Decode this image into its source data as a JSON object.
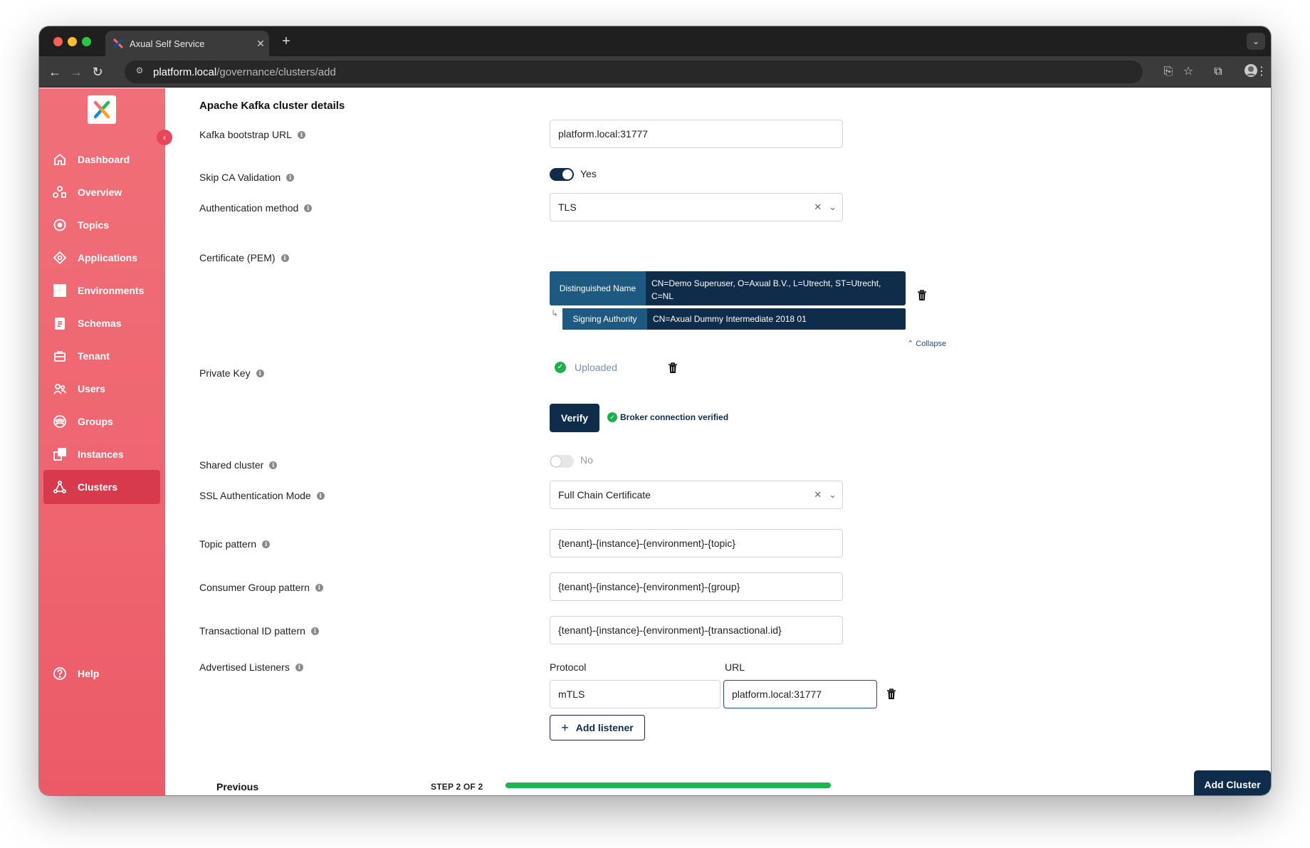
{
  "browser": {
    "tab_title": "Axual Self Service",
    "tab_close": "✕",
    "new_tab": "+",
    "url_host": "platform.local",
    "url_path": "/governance/clusters/add"
  },
  "sidebar": {
    "items": [
      {
        "label": "Dashboard",
        "icon": "home-icon"
      },
      {
        "label": "Overview",
        "icon": "overview-icon"
      },
      {
        "label": "Topics",
        "icon": "topics-icon"
      },
      {
        "label": "Applications",
        "icon": "applications-icon"
      },
      {
        "label": "Environments",
        "icon": "environments-icon"
      },
      {
        "label": "Schemas",
        "icon": "schemas-icon"
      },
      {
        "label": "Tenant",
        "icon": "tenant-icon"
      },
      {
        "label": "Users",
        "icon": "users-icon"
      },
      {
        "label": "Groups",
        "icon": "groups-icon"
      },
      {
        "label": "Instances",
        "icon": "instances-icon"
      },
      {
        "label": "Clusters",
        "icon": "clusters-icon",
        "active": true
      }
    ],
    "help": "Help"
  },
  "form": {
    "section_title": "Apache Kafka cluster details",
    "bootstrap": {
      "label": "Kafka bootstrap URL",
      "value": "platform.local:31777"
    },
    "skip_ca": {
      "label": "Skip CA Validation",
      "state": "Yes"
    },
    "auth_method": {
      "label": "Authentication method",
      "value": "TLS"
    },
    "certificate": {
      "label": "Certificate (PEM)",
      "dn_key": "Distinguished Name",
      "dn_value": "CN=Demo Superuser, O=Axual B.V., L=Utrecht, ST=Utrecht, C=NL",
      "sa_key": "Signing Authority",
      "sa_value": "CN=Axual Dummy Intermediate 2018 01",
      "collapse": "Collapse"
    },
    "private_key": {
      "label": "Private Key",
      "status": "Uploaded"
    },
    "verify": {
      "button": "Verify",
      "status": "Broker connection verified"
    },
    "shared_cluster": {
      "label": "Shared cluster",
      "state": "No"
    },
    "ssl_mode": {
      "label": "SSL Authentication Mode",
      "value": "Full Chain Certificate"
    },
    "topic_pattern": {
      "label": "Topic pattern",
      "value": "{tenant}-{instance}-{environment}-{topic}"
    },
    "group_pattern": {
      "label": "Consumer Group pattern",
      "value": "{tenant}-{instance}-{environment}-{group}"
    },
    "txn_pattern": {
      "label": "Transactional ID pattern",
      "value": "{tenant}-{instance}-{environment}-{transactional.id}"
    },
    "listeners": {
      "label": "Advertised Listeners",
      "protocol_header": "Protocol",
      "url_header": "URL",
      "protocol": "mTLS",
      "url": "platform.local:31777",
      "add_button": "Add listener"
    }
  },
  "footer": {
    "previous": "Previous",
    "step": "STEP 2 OF 2",
    "progress": 1.0,
    "submit": "Add Cluster"
  },
  "colors": {
    "sidebar": "#ee6570",
    "primary": "#0f2d4a",
    "success": "#1eb452"
  }
}
